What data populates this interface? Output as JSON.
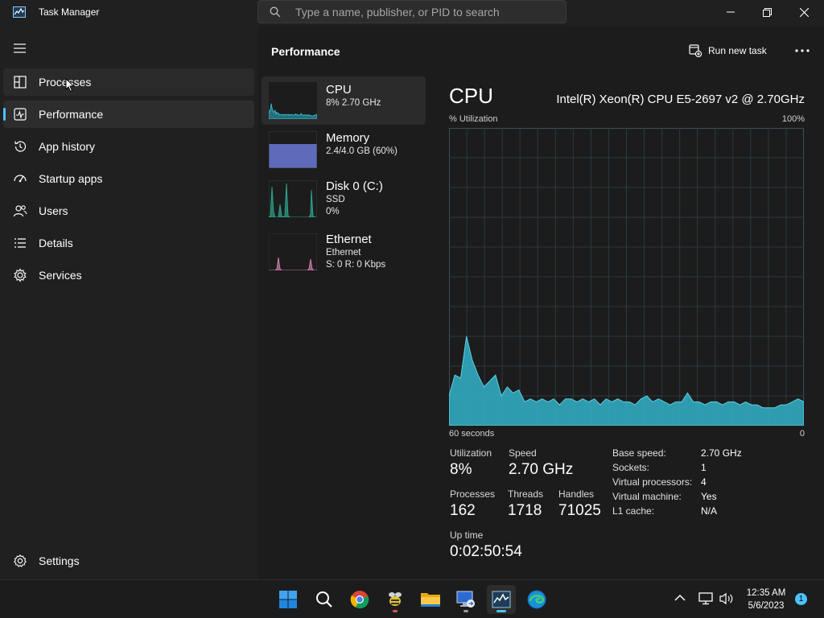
{
  "window": {
    "title": "Task Manager",
    "search_placeholder": "Type a name, publisher, or PID to search"
  },
  "nav": {
    "items": [
      {
        "label": "Processes",
        "icon": "processes-icon"
      },
      {
        "label": "Performance",
        "icon": "performance-icon"
      },
      {
        "label": "App history",
        "icon": "app-history-icon"
      },
      {
        "label": "Startup apps",
        "icon": "startup-apps-icon"
      },
      {
        "label": "Users",
        "icon": "users-icon"
      },
      {
        "label": "Details",
        "icon": "details-icon"
      },
      {
        "label": "Services",
        "icon": "services-icon"
      }
    ],
    "settings_label": "Settings",
    "active_item": "Performance"
  },
  "header": {
    "title": "Performance",
    "run_new_task": "Run new task"
  },
  "devices": [
    {
      "name": "CPU",
      "line1": "8%  2.70 GHz",
      "line2": "",
      "color": "#31b2c9"
    },
    {
      "name": "Memory",
      "line1": "2.4/4.0 GB (60%)",
      "line2": "",
      "color": "#6b78d6"
    },
    {
      "name": "Disk 0 (C:)",
      "line1": "SSD",
      "line2": "0%",
      "color": "#2fb39a"
    },
    {
      "name": "Ethernet",
      "line1": "Ethernet",
      "line2": "S: 0  R: 0 Kbps",
      "color": "#e284b9"
    }
  ],
  "cpu": {
    "heading": "CPU",
    "model": "Intel(R) Xeon(R) CPU E5-2697 v2 @ 2.70GHz",
    "y_label": "% Utilization",
    "y_max_label": "100%",
    "x_left_label": "60 seconds",
    "x_right_label": "0",
    "stats": {
      "utilization_label": "Utilization",
      "utilization": "8%",
      "speed_label": "Speed",
      "speed": "2.70 GHz",
      "processes_label": "Processes",
      "processes": "162",
      "threads_label": "Threads",
      "threads": "1718",
      "handles_label": "Handles",
      "handles": "71025",
      "uptime_label": "Up time",
      "uptime": "0:02:50:54"
    },
    "specs": [
      {
        "key": "Base speed:",
        "value": "2.70 GHz"
      },
      {
        "key": "Sockets:",
        "value": "1"
      },
      {
        "key": "Virtual processors:",
        "value": "4"
      },
      {
        "key": "Virtual machine:",
        "value": "Yes"
      },
      {
        "key": "L1 cache:",
        "value": "N/A"
      }
    ],
    "history_percent": [
      10,
      17,
      16,
      30,
      22,
      17,
      13,
      15,
      17,
      10,
      13,
      11,
      12,
      8,
      9,
      8,
      9,
      8,
      9,
      7,
      9,
      9,
      8,
      9,
      8,
      9,
      7,
      9,
      8,
      9,
      8,
      8,
      7,
      9,
      10,
      8,
      9,
      8,
      7,
      8,
      8,
      11,
      8,
      8,
      7,
      8,
      8,
      7,
      8,
      8,
      7,
      8,
      7,
      7,
      6,
      6,
      6,
      7,
      7,
      8,
      9,
      8
    ],
    "graph_color": "#31b2c9"
  },
  "taskbar": {
    "apps": [
      "start-icon",
      "search-icon",
      "chrome-icon",
      "bee-app-icon",
      "file-explorer-icon",
      "remote-desktop-icon",
      "task-manager-icon",
      "edge-icon"
    ],
    "time": "12:35 AM",
    "date": "5/6/2023",
    "notifications": "1"
  }
}
